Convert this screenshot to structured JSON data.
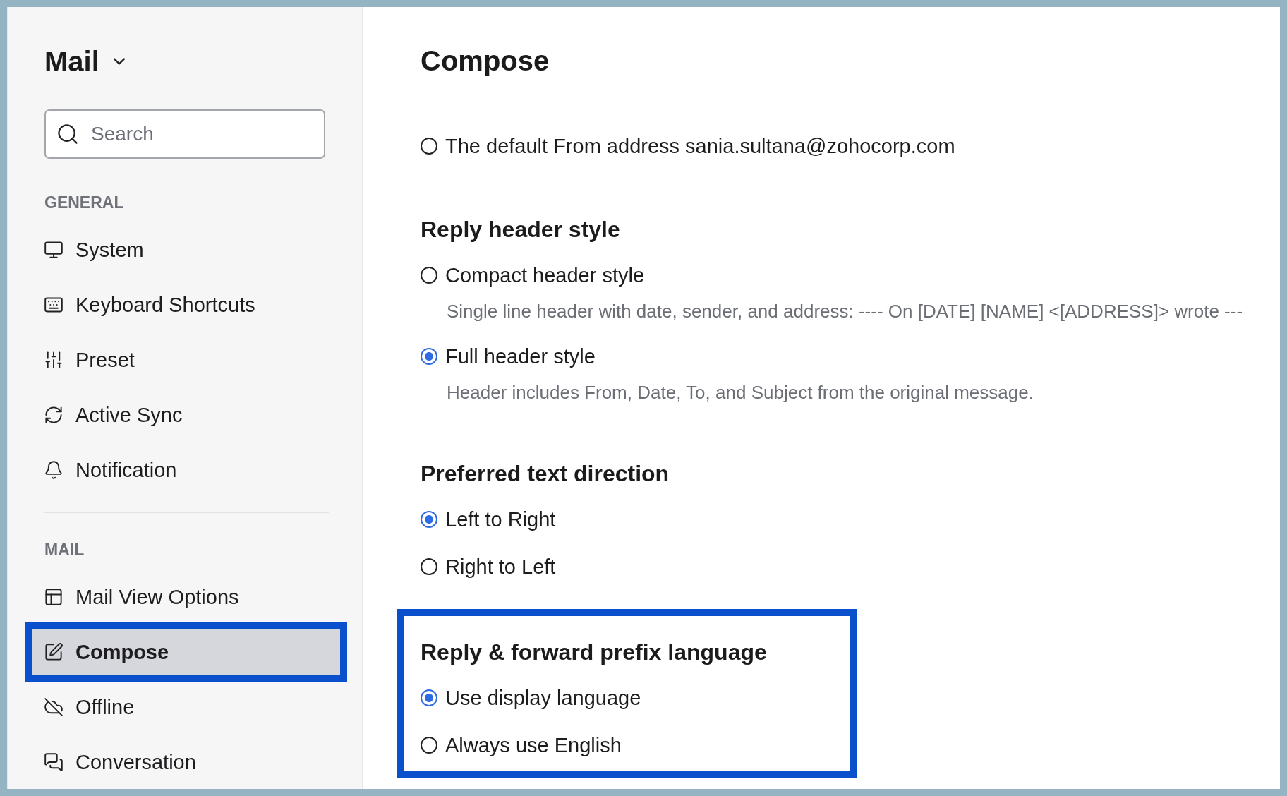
{
  "sidebar": {
    "title": "Mail",
    "search": {
      "placeholder": "Search"
    },
    "groups": [
      {
        "label": "GENERAL",
        "items": [
          {
            "label": "System",
            "selected": false,
            "highlighted": false
          },
          {
            "label": "Keyboard Shortcuts",
            "selected": false,
            "highlighted": false
          },
          {
            "label": "Preset",
            "selected": false,
            "highlighted": false
          },
          {
            "label": "Active Sync",
            "selected": false,
            "highlighted": false
          },
          {
            "label": "Notification",
            "selected": false,
            "highlighted": false
          }
        ]
      },
      {
        "label": "MAIL",
        "items": [
          {
            "label": "Mail View Options",
            "selected": false,
            "highlighted": false
          },
          {
            "label": "Compose",
            "selected": true,
            "highlighted": true
          },
          {
            "label": "Offline",
            "selected": false,
            "highlighted": false
          },
          {
            "label": "Conversation",
            "selected": false,
            "highlighted": false
          }
        ]
      }
    ]
  },
  "main": {
    "title": "Compose",
    "sections": [
      {
        "highlighted": false,
        "options": [
          {
            "label": "The default From address sania.sultana@zohocorp.com",
            "selected": false
          }
        ]
      },
      {
        "heading": "Reply header style",
        "highlighted": false,
        "options": [
          {
            "label": "Compact header style",
            "selected": false,
            "description": "Single line header with date, sender, and address: ---- On [DATE] [NAME] <[ADDRESS]> wrote ---"
          },
          {
            "label": "Full header style",
            "selected": true,
            "description": "Header includes From, Date, To, and Subject from the original message."
          }
        ]
      },
      {
        "heading": "Preferred text direction",
        "highlighted": false,
        "options": [
          {
            "label": "Left to Right",
            "selected": true
          },
          {
            "label": "Right to Left",
            "selected": false
          }
        ]
      },
      {
        "heading": "Reply & forward prefix language",
        "highlighted": true,
        "options": [
          {
            "label": "Use display language",
            "selected": true
          },
          {
            "label": "Always use English",
            "selected": false
          }
        ]
      }
    ]
  }
}
